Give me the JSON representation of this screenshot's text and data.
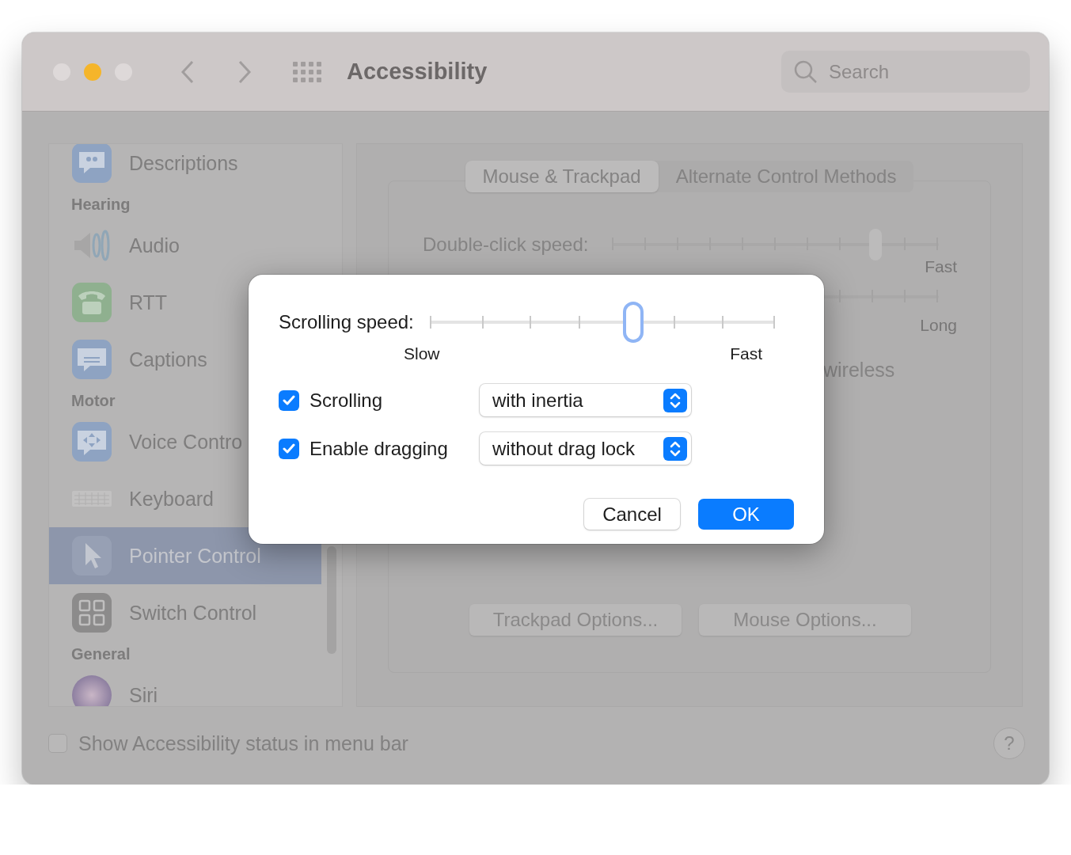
{
  "window": {
    "title": "Accessibility",
    "search": {
      "placeholder": "Search"
    }
  },
  "sidebar": {
    "items": [
      {
        "kind": "item",
        "label": "Descriptions",
        "selected": false
      },
      {
        "kind": "section",
        "label": "Hearing"
      },
      {
        "kind": "item",
        "label": "Audio",
        "selected": false
      },
      {
        "kind": "item",
        "label": "RTT",
        "selected": false
      },
      {
        "kind": "item",
        "label": "Captions",
        "selected": false
      },
      {
        "kind": "section",
        "label": "Motor"
      },
      {
        "kind": "item",
        "label": "Voice Contro",
        "selected": false
      },
      {
        "kind": "item",
        "label": "Keyboard",
        "selected": false
      },
      {
        "kind": "item",
        "label": "Pointer Control",
        "selected": true
      },
      {
        "kind": "item",
        "label": "Switch Control",
        "selected": false
      },
      {
        "kind": "section",
        "label": "General"
      },
      {
        "kind": "item",
        "label": "Siri",
        "selected": false
      }
    ]
  },
  "panel": {
    "tabs": [
      {
        "label": "Mouse & Trackpad",
        "selected": true
      },
      {
        "label": "Alternate Control Methods",
        "selected": false
      }
    ],
    "double_click_speed": {
      "label": "Double-click speed:",
      "level": 0.79,
      "max_label": "Fast"
    },
    "slider_2": {
      "max_label": "Long"
    },
    "partial_text": "wireless",
    "buttons": [
      "Trackpad Options...",
      "Mouse Options..."
    ]
  },
  "footer": {
    "checkbox": {
      "label": "Show Accessibility status in menu bar",
      "checked": false
    },
    "help": "?"
  },
  "dialog": {
    "scrolling_speed": {
      "label": "Scrolling speed:",
      "level": 0.57,
      "min_label": "Slow",
      "max_label": "Fast"
    },
    "options": [
      {
        "label": "Scrolling",
        "checked": true,
        "value": "with inertia"
      },
      {
        "label": "Enable dragging",
        "checked": true,
        "value": "without drag lock"
      }
    ],
    "buttons": [
      {
        "label": "Cancel",
        "default": false
      },
      {
        "label": "OK",
        "default": true
      }
    ]
  }
}
